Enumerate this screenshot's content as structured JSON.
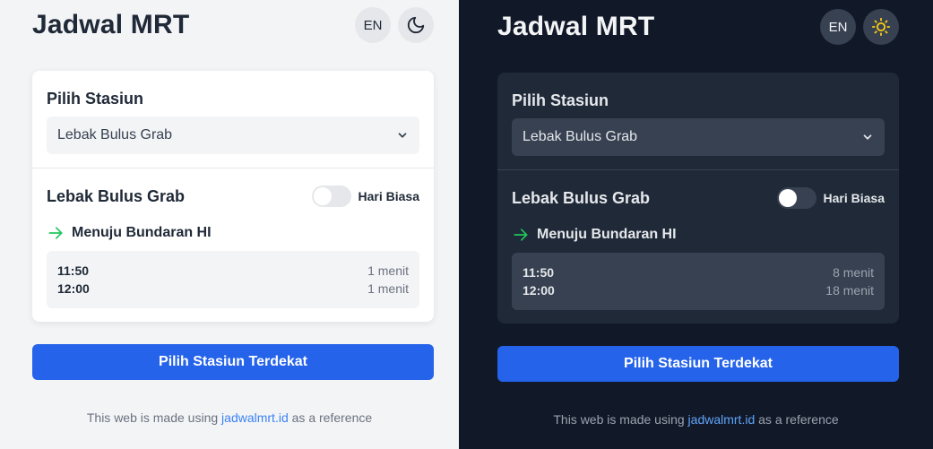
{
  "light": {
    "title": "Jadwal MRT",
    "lang_button": "EN",
    "theme_icon": "moon-icon",
    "select_label": "Pilih Stasiun",
    "selected_station": "Lebak Bulus Grab",
    "station_name": "Lebak Bulus Grab",
    "toggle_label": "Hari Biasa",
    "toggle_on": false,
    "direction": "Menuju Bundaran HI",
    "schedule": [
      {
        "time": "11:50",
        "minutes": "1 menit"
      },
      {
        "time": "12:00",
        "minutes": "1 menit"
      }
    ],
    "nearest_button": "Pilih Stasiun Terdekat",
    "footer_prefix": "This web is made using ",
    "footer_link": "jadwalmrt.id",
    "footer_suffix": " as a reference"
  },
  "dark": {
    "title": "Jadwal MRT",
    "lang_button": "EN",
    "theme_icon": "sun-icon",
    "select_label": "Pilih Stasiun",
    "selected_station": "Lebak Bulus Grab",
    "station_name": "Lebak Bulus Grab",
    "toggle_label": "Hari Biasa",
    "toggle_on": false,
    "direction": "Menuju Bundaran HI",
    "schedule": [
      {
        "time": "11:50",
        "minutes": "8 menit"
      },
      {
        "time": "12:00",
        "minutes": "18 menit"
      }
    ],
    "nearest_button": "Pilih Stasiun Terdekat",
    "footer_prefix": "This web is made using ",
    "footer_link": "jadwalmrt.id",
    "footer_suffix": " as a reference"
  },
  "colors": {
    "accent": "#2563eb",
    "arrow_green": "#22c55e",
    "sun_yellow": "#facc15",
    "light_bg": "#f3f4f6",
    "dark_bg": "#111827"
  }
}
